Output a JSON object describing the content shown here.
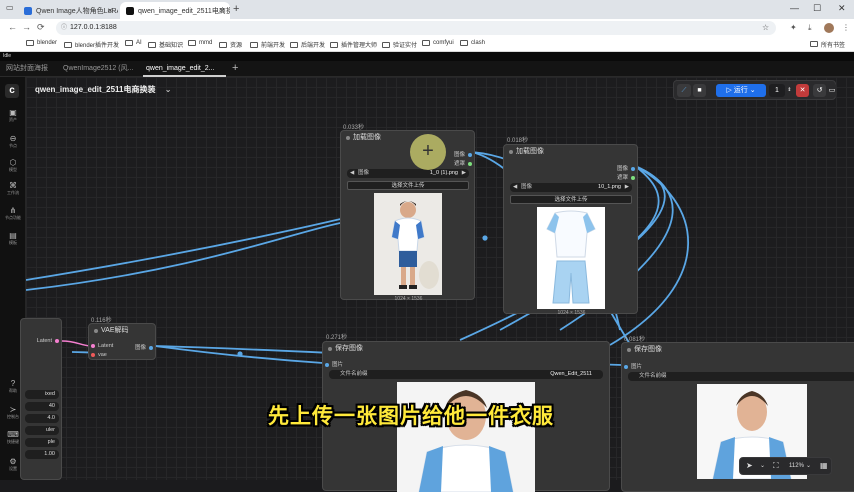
{
  "browser": {
    "tabs": [
      {
        "title": "Qwen Image人物角色LoRA训...",
        "active": false
      },
      {
        "title": "qwen_image_edit_2511电商换...",
        "active": true
      }
    ],
    "url": "127.0.0.1:8188",
    "bookmarks": [
      "blender",
      "blender插件开发",
      "AI",
      "基础知识",
      "mmd",
      "资源",
      "前端开发",
      "后端开发",
      "插件管理大师",
      "验证实付",
      "comfyui",
      "clash"
    ],
    "all_bookmarks": "所有书签"
  },
  "app": {
    "status": "Idle",
    "workspace_tabs": [
      "网站封面海报",
      "QwenImage2512 (风...",
      "qwen_image_edit_2..."
    ],
    "workflow_name": "qwen_image_edit_2511电商换装",
    "run_label": "运行",
    "run_count": "1",
    "sidebar": [
      "资产",
      "节点",
      "模型",
      "工作流",
      "节点功能",
      "模板"
    ],
    "sidebar_bottom": [
      "帮助",
      "控制台",
      "快捷键",
      "设置"
    ],
    "zoom": "112%"
  },
  "nodes": {
    "load1": {
      "time": "0.033秒",
      "title": "加载图像",
      "out1": "图像",
      "out2": "遮罩",
      "image_label": "图像",
      "image_value": "1_0 (1).png",
      "upload": "选择文件上传",
      "dims": "1024 × 1536"
    },
    "load2": {
      "time": "0.018秒",
      "title": "加载图像",
      "out1": "图像",
      "out2": "遮罩",
      "image_label": "图像",
      "image_value": "10_1.png",
      "upload": "选择文件上传",
      "dims": "1024 × 1536"
    },
    "vae": {
      "time": "0.116秒",
      "title": "VAE解码",
      "in1": "Latent",
      "in2": "vae",
      "out1": "图像"
    },
    "save1": {
      "time": "0.271秒",
      "title": "保存图像",
      "in1": "图片",
      "prefix_label": "文件名前缀",
      "prefix_value": "Qwen_Edit_2511"
    },
    "save2": {
      "time": "0.081秒",
      "title": "保存图像",
      "in1": "图片",
      "prefix_label": "文件名前缀"
    },
    "ksampler": {
      "out": "Latent",
      "widgets": [
        "ixed",
        "40",
        "4.0",
        "uler",
        "ple",
        "1.00"
      ]
    }
  },
  "subtitle": "先上传一张图片给他一件衣服",
  "colors": {
    "accent": "#1f6feb",
    "link": "#5aa7e6",
    "subtitle": "#ffe93a",
    "stop": "#c23b3b"
  }
}
